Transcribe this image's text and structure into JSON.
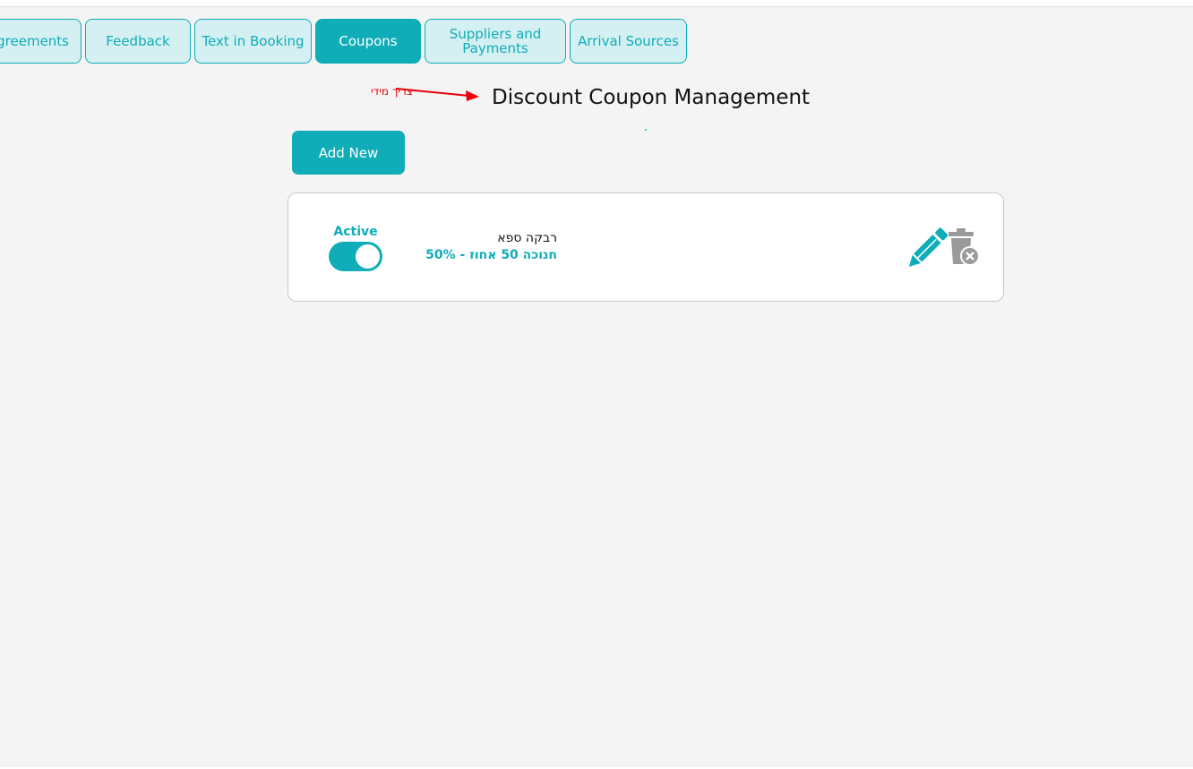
{
  "tabs": [
    {
      "label": "Agreements",
      "visible_text": "greements"
    },
    {
      "label": "Feedback"
    },
    {
      "label": "Text in Booking"
    },
    {
      "label": "Coupons"
    },
    {
      "label": "Suppliers and Payments"
    },
    {
      "label": "Arrival Sources"
    }
  ],
  "active_tab": "Coupons",
  "page": {
    "title": "Discount Coupon Management",
    "annotation": "צריך מידי",
    "add_button": "Add New"
  },
  "coupons": [
    {
      "status_label": "Active",
      "active": true,
      "name": "רבקה ספא",
      "description": "חנוכה 50 אחוז - 50%"
    }
  ],
  "icons": {
    "edit": "pencil-icon",
    "delete": "trash-remove-icon"
  },
  "colors": {
    "accent": "#0eadb8",
    "tab_bg": "#d5f0f2",
    "annotation": "#e8000b",
    "delete_icon": "#9a9a9a"
  }
}
